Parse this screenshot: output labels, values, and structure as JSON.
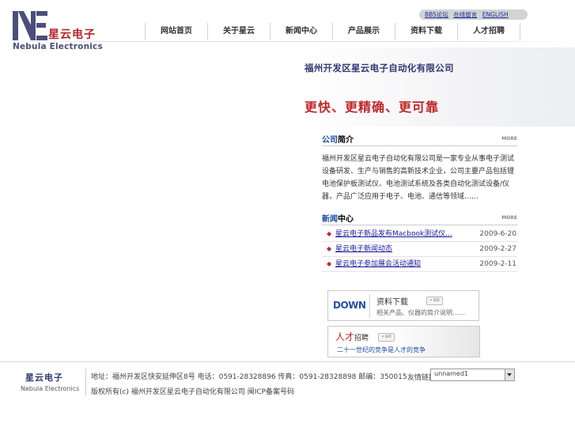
{
  "header": {
    "logo_cn": "星云电子",
    "logo_en": "Nebula Electronics",
    "toplinks": [
      "BBS论坛",
      "在线留言",
      "ENGLISH"
    ],
    "nav": [
      "网站首页",
      "关于星云",
      "新闻中心",
      "产品展示",
      "资料下载",
      "人才招聘"
    ]
  },
  "banner": {
    "company": "福州开发区星云电子自动化有限公司",
    "slogan": "更快、更精确、更可靠"
  },
  "intro": {
    "title_a": "公司",
    "title_b": "简介",
    "more": "MORE",
    "text": "福州开发区星云电子自动化有限公司是一家专业从事电子测试设备研发、生产与销售的高新技术企业，公司主要产品包括锂电池保护板测试仪、电池测试系统及各类自动化测试设备/仪器，产品广泛应用于电子、电池、通信等领域……"
  },
  "news": {
    "title_a": "新闻",
    "title_b": "中心",
    "more": "MORE",
    "items": [
      {
        "title": "星云电子新品发布Macbook测试仪...",
        "date": "2009-6-20"
      },
      {
        "title": "星云电子新闻动态",
        "date": "2009-2-27"
      },
      {
        "title": "星云电子参加展会活动通知",
        "date": "2009-2-11"
      }
    ]
  },
  "download": {
    "logo": "DOWN",
    "title": "资料下载",
    "go": "• GO",
    "desc": "相关产品、仪器的简介说明……"
  },
  "jobs": {
    "title_big": "人才",
    "title_small": "招聘",
    "go": "• GO",
    "desc": "二十一世纪的竞争是人才的竞争"
  },
  "footer": {
    "logo_cn": "星云电子",
    "logo_en": "Nebula Electronics",
    "address": "地址：福州开发区快安延伸区8号 电话：0591-28328896 传真：0591-28328898 邮编：350015",
    "copyright": "版权所有(c) 福州开发区星云电子自动化有限公司 闽ICP备案号码",
    "links_label": "友情链接",
    "select_value": "unnamed1"
  },
  "colors": {
    "brand_red": "#c0282a",
    "brand_navy": "#333a72",
    "link_blue": "#1a1a9a"
  }
}
